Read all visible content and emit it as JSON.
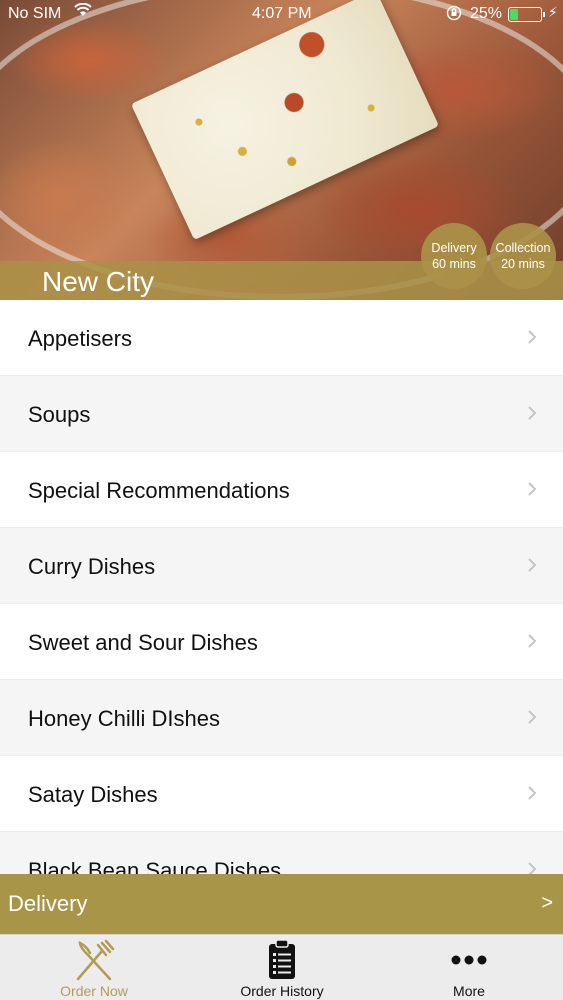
{
  "status_bar": {
    "carrier": "No SIM",
    "time": "4:07 PM",
    "battery_percent": "25%",
    "battery_level": 0.25
  },
  "header": {
    "city": "New City",
    "delivery_badge": {
      "title": "Delivery",
      "time": "60 mins"
    },
    "collection_badge": {
      "title": "Collection",
      "time": "20 mins"
    }
  },
  "categories": [
    "Appetisers",
    "Soups",
    "Special Recommendations",
    "Curry Dishes",
    "Sweet and Sour Dishes",
    "Honey Chilli DIshes",
    "Satay Dishes",
    "Black Bean Sauce Dishes"
  ],
  "delivery_bar": {
    "label": "Delivery",
    "arrow": ">"
  },
  "tabs": [
    {
      "label": "Order Now",
      "icon": "fork-knife-icon",
      "active": true
    },
    {
      "label": "Order History",
      "icon": "clipboard-icon",
      "active": false
    },
    {
      "label": "More",
      "icon": "more-dots-icon",
      "active": false
    }
  ],
  "colors": {
    "accent": "#a99548",
    "active_tab": "#b39a55"
  }
}
